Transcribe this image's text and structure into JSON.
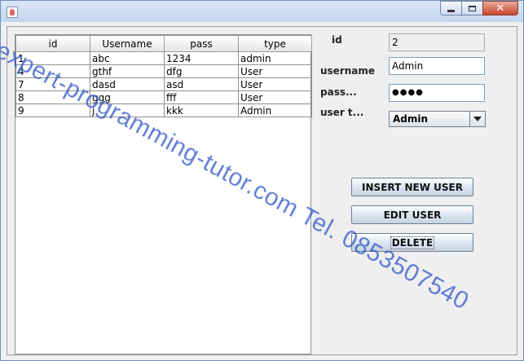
{
  "window": {
    "icon": "java-cup-icon",
    "buttons": [
      "minimize-icon",
      "maximize-icon",
      "close-icon"
    ],
    "close_glyph": "✕"
  },
  "table": {
    "columns": [
      "id",
      "Username",
      "pass",
      "type"
    ],
    "rows": [
      [
        "1",
        "abc",
        "1234",
        "admin"
      ],
      [
        "4",
        "gthf",
        "dfg",
        "User"
      ],
      [
        "7",
        "dasd",
        "asd",
        "User"
      ],
      [
        "8",
        "ggg",
        "fff",
        "User"
      ],
      [
        "9",
        "j",
        "kkk",
        "Admin"
      ]
    ]
  },
  "form": {
    "id_label": "id",
    "id_value": "2",
    "username_label": "username",
    "username_value": "Admin",
    "pass_label": "pass...",
    "pass_value": "●●●●",
    "usertype_label": "user t...",
    "usertype_value": "Admin"
  },
  "buttons": {
    "insert": "INSERT NEW USER",
    "edit": "EDIT USER",
    "delete": "DELETE"
  },
  "watermark": "expert-programming-tutor.com Tel. 0853507540"
}
